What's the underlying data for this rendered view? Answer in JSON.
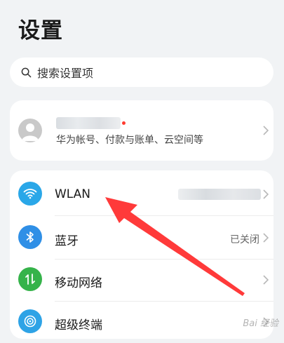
{
  "header": {
    "title": "设置"
  },
  "search": {
    "placeholder": "搜索设置项"
  },
  "account": {
    "subtitle": "华为帐号、付款与账单、云空间等"
  },
  "settings": {
    "items": [
      {
        "label": "WLAN",
        "value": "",
        "icon": "wifi-icon",
        "color": "#2aa7e8"
      },
      {
        "label": "蓝牙",
        "value": "已关闭",
        "icon": "bluetooth-icon",
        "color": "#2f8fe6"
      },
      {
        "label": "移动网络",
        "value": "",
        "icon": "mobile-data-icon",
        "color": "#35b34a"
      },
      {
        "label": "超级终端",
        "value": "",
        "icon": "super-device-icon",
        "color": "#2ea3e6"
      }
    ]
  },
  "annotation": {
    "arrow_color": "#ff3a3a"
  },
  "watermark": {
    "text": "Bai 经验"
  }
}
